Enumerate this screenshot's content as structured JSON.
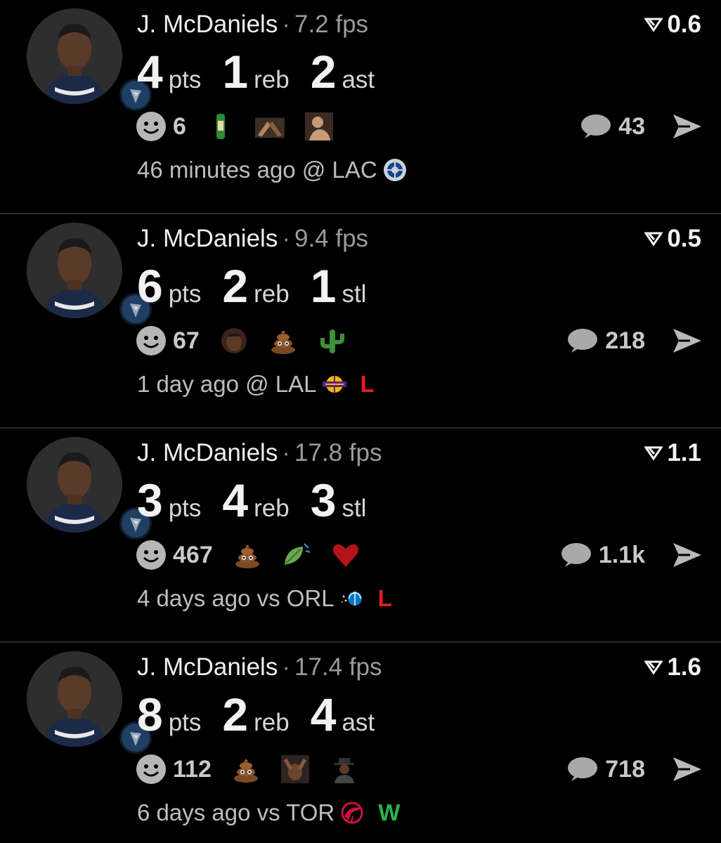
{
  "posts": [
    {
      "player": "J. McDaniels",
      "separator": "·",
      "fps": "7.2 fps",
      "score": "0.6",
      "stats": [
        {
          "value": "4",
          "label": "pts"
        },
        {
          "value": "1",
          "label": "reb"
        },
        {
          "value": "2",
          "label": "ast"
        }
      ],
      "reaction_count": "6",
      "reaction_icons": [
        "bottle-reaction-icon",
        "arm-wrestle-reaction-icon",
        "shouting-man-reaction-icon"
      ],
      "comment_count": "43",
      "time_text": "46 minutes ago @ LAC",
      "opponent_logo": "clippers-logo",
      "result": ""
    },
    {
      "player": "J. McDaniels",
      "separator": "·",
      "fps": "9.4 fps",
      "score": "0.5",
      "stats": [
        {
          "value": "6",
          "label": "pts"
        },
        {
          "value": "2",
          "label": "reb"
        },
        {
          "value": "1",
          "label": "stl"
        }
      ],
      "reaction_count": "67",
      "reaction_icons": [
        "player-face-reaction-icon",
        "poop-emoji-icon",
        "cactus-emoji-icon"
      ],
      "comment_count": "218",
      "time_text": "1 day ago @ LAL",
      "opponent_logo": "lakers-logo",
      "result": "L"
    },
    {
      "player": "J. McDaniels",
      "separator": "·",
      "fps": "17.8 fps",
      "score": "1.1",
      "stats": [
        {
          "value": "3",
          "label": "pts"
        },
        {
          "value": "4",
          "label": "reb"
        },
        {
          "value": "3",
          "label": "stl"
        }
      ],
      "reaction_count": "467",
      "reaction_icons": [
        "poop-emoji-icon",
        "leaf-wind-emoji-icon",
        "heart-emoji-icon"
      ],
      "comment_count": "1.1k",
      "time_text": "4 days ago vs ORL",
      "opponent_logo": "magic-logo",
      "result": "L"
    },
    {
      "player": "J. McDaniels",
      "separator": "·",
      "fps": "17.4 fps",
      "score": "1.6",
      "stats": [
        {
          "value": "8",
          "label": "pts"
        },
        {
          "value": "2",
          "label": "reb"
        },
        {
          "value": "4",
          "label": "ast"
        }
      ],
      "reaction_count": "112",
      "reaction_icons": [
        "poop-emoji-icon",
        "facepalm-reaction-icon",
        "man-in-hat-reaction-icon"
      ],
      "comment_count": "718",
      "time_text": "6 days ago vs TOR",
      "opponent_logo": "raptors-logo",
      "result": "W"
    }
  ],
  "colors": {
    "background": "#000000",
    "divider": "#2b2b2b",
    "loss": "#e21d1d",
    "win": "#26b34a",
    "muted": "#9a9a9a"
  }
}
